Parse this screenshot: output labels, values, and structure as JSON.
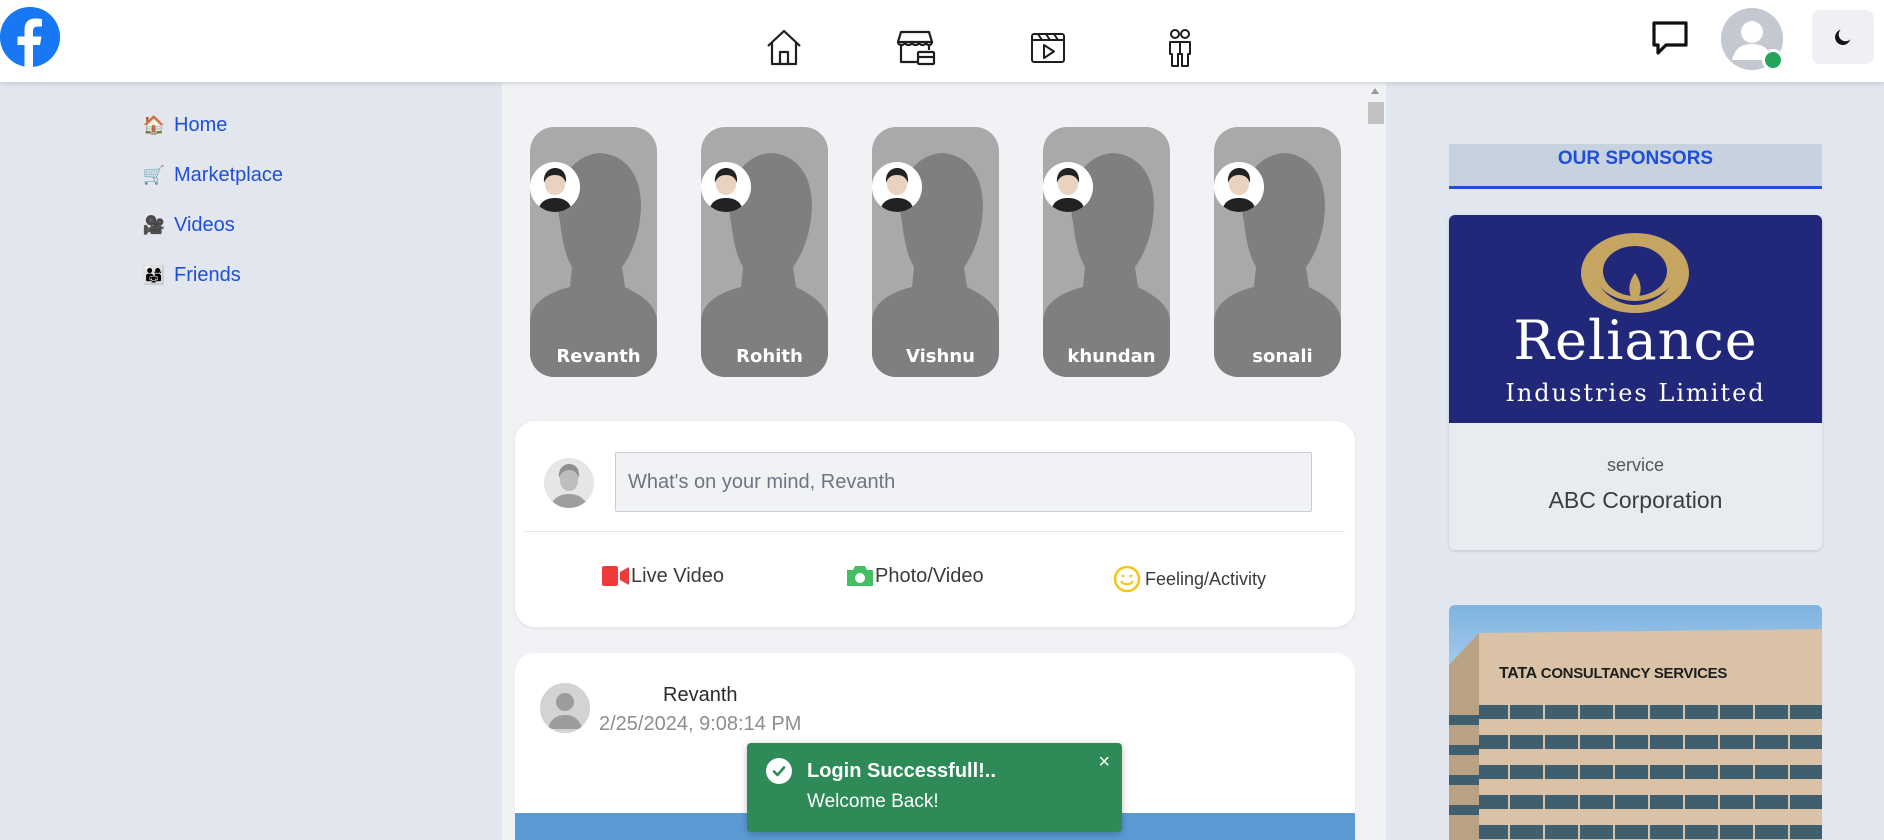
{
  "nav": {
    "icons": [
      "facebook-logo",
      "home-icon",
      "marketplace-icon",
      "video-icon",
      "friends-icon",
      "chat-icon",
      "profile-avatar",
      "dark-mode-icon"
    ]
  },
  "sidebar": {
    "items": [
      {
        "label": "Home",
        "emoji": "🏠"
      },
      {
        "label": "Marketplace",
        "emoji": "🛒"
      },
      {
        "label": "Videos",
        "emoji": "🎥"
      },
      {
        "label": "Friends",
        "emoji": "👨‍👩‍👧"
      }
    ]
  },
  "stories": [
    {
      "name": "Revanth"
    },
    {
      "name": "Rohith"
    },
    {
      "name": "Vishnu"
    },
    {
      "name": "khundan"
    },
    {
      "name": "sonali"
    }
  ],
  "composer": {
    "placeholder": "What's on your mind, Revanth",
    "actions": {
      "live": "Live Video",
      "photo": "Photo/Video",
      "feeling": "Feeling/Activity"
    }
  },
  "post": {
    "author": "Revanth",
    "timestamp": "2/25/2024, 9:08:14 PM"
  },
  "toast": {
    "title": "Login Successfull!..",
    "message": "Welcome Back!",
    "close": "×"
  },
  "sponsors": {
    "heading": "OUR SPONSORS",
    "cards": [
      {
        "logo_word": "Reliance",
        "logo_sub": "Industries Limited",
        "type": "service",
        "name": "ABC Corporation"
      },
      {
        "sign": "CONSULTANCY SERVICES",
        "brand": "TATA"
      }
    ]
  },
  "colors": {
    "brand_blue": "#1877f2",
    "link_blue": "#1f4fd8",
    "toast_green": "#2e8b57",
    "online_green": "#23a55a"
  }
}
